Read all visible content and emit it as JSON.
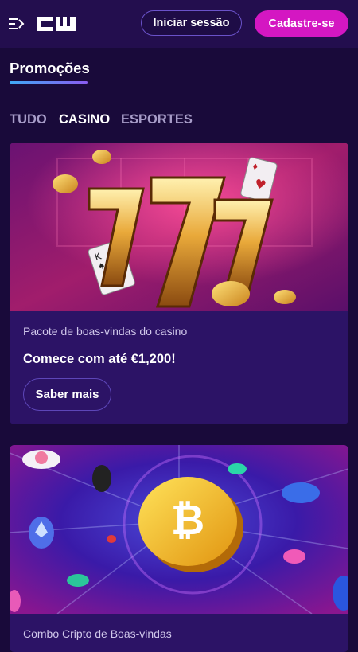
{
  "header": {
    "login_label": "Iniciar sessão",
    "signup_label": "Cadastre-se",
    "menu_icon": "menu-expand-icon",
    "logo": "cw-logo"
  },
  "page": {
    "title": "Promoções"
  },
  "tabs": [
    {
      "label": "TUDO",
      "active": false
    },
    {
      "label": "CASINO",
      "active": true
    },
    {
      "label": "ESPORTES",
      "active": false
    }
  ],
  "promotions": [
    {
      "subtitle": "Pacote de boas-vindas do casino",
      "headline": "Comece com até €1,200!",
      "button_label": "Saber mais"
    },
    {
      "subtitle": "Combo Cripto de Boas-vindas"
    }
  ],
  "colors": {
    "background": "#190a3a",
    "header": "#230e4e",
    "accent_pink": "#d417c2",
    "card": "#2c1366"
  }
}
